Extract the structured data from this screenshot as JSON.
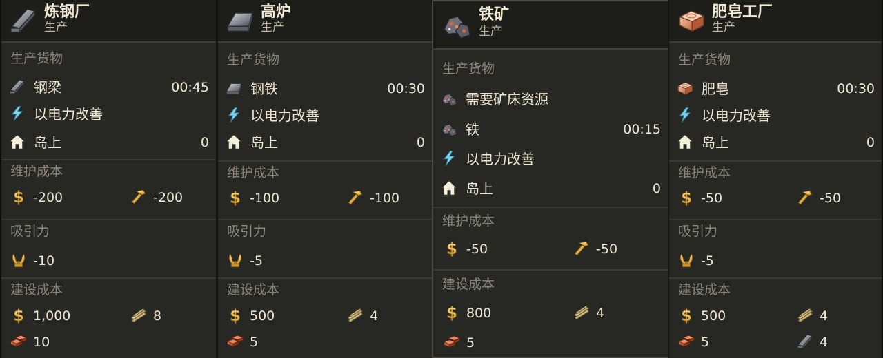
{
  "cards": [
    {
      "title": "炼钢厂",
      "subtitle": "生产",
      "header_icon": "steel-beam-icon",
      "production_label": "生产货物",
      "product": {
        "name": "钢梁",
        "time": "00:45",
        "icon": "steel-beam-icon"
      },
      "electricity": "以电力改善",
      "island": {
        "label": "岛上",
        "count": "0"
      },
      "maintenance_label": "维护成本",
      "maintenance": {
        "money": "-200",
        "workforce": "-200"
      },
      "attractiveness_label": "吸引力",
      "attractiveness": "-10",
      "construction_label": "建设成本",
      "construction": {
        "money": "1,000",
        "timber": "8",
        "bricks": "10"
      }
    },
    {
      "title": "高炉",
      "subtitle": "生产",
      "header_icon": "steel-ingot-icon",
      "production_label": "生产货物",
      "product": {
        "name": "钢铁",
        "time": "00:30",
        "icon": "steel-ingot-icon"
      },
      "electricity": "以电力改善",
      "island": {
        "label": "岛上",
        "count": "0"
      },
      "maintenance_label": "维护成本",
      "maintenance": {
        "money": "-100",
        "workforce": "-100"
      },
      "attractiveness_label": "吸引力",
      "attractiveness": "-5",
      "construction_label": "建设成本",
      "construction": {
        "money": "500",
        "timber": "4",
        "bricks": "5"
      }
    },
    {
      "title": "铁矿",
      "subtitle": "生产",
      "header_icon": "iron-ore-icon",
      "production_label": "生产货物",
      "requirement": "需要矿床资源",
      "product": {
        "name": "铁",
        "time": "00:15",
        "icon": "iron-ore-icon"
      },
      "electricity": "以电力改善",
      "island": {
        "label": "岛上",
        "count": "0"
      },
      "maintenance_label": "维护成本",
      "maintenance": {
        "money": "-50",
        "workforce": "-50"
      },
      "construction_label": "建设成本",
      "construction": {
        "money": "800",
        "timber": "4",
        "bricks": "5"
      }
    },
    {
      "title": "肥皂工厂",
      "subtitle": "生产",
      "header_icon": "soap-icon",
      "production_label": "生产货物",
      "product": {
        "name": "肥皂",
        "time": "00:30",
        "icon": "soap-icon"
      },
      "electricity": "以电力改善",
      "island": {
        "label": "岛上",
        "count": "0"
      },
      "maintenance_label": "维护成本",
      "maintenance": {
        "money": "-50",
        "workforce": "-50"
      },
      "attractiveness_label": "吸引力",
      "attractiveness": "-5",
      "construction_label": "建设成本",
      "construction": {
        "money": "500",
        "timber": "4",
        "bricks": "5",
        "steel_beams": "4"
      }
    }
  ]
}
